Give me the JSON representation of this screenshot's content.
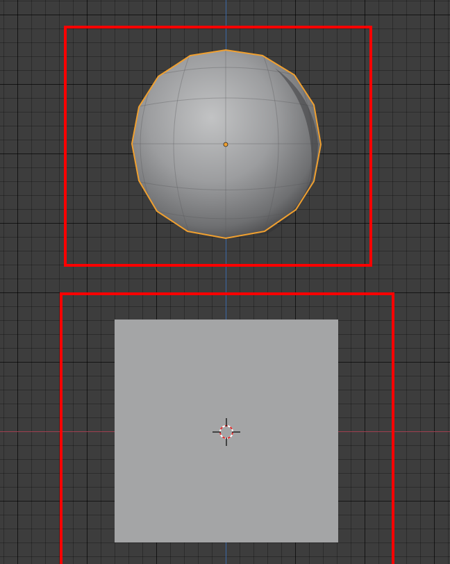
{
  "viewport": {
    "background": "#3d3d3d",
    "axis_colors": {
      "x_axis": "#a04050",
      "y_axis": "#3a68a8"
    }
  },
  "scene": {
    "objects": [
      {
        "name": "uv-sphere",
        "selected": true,
        "outline_color": "#f0a030"
      },
      {
        "name": "plane",
        "selected": false,
        "color": "#a4a5a6"
      }
    ],
    "highlight_color": "#ff0000",
    "cursor_icon": "3d-cursor-icon",
    "origin_icon": "object-origin-icon"
  }
}
